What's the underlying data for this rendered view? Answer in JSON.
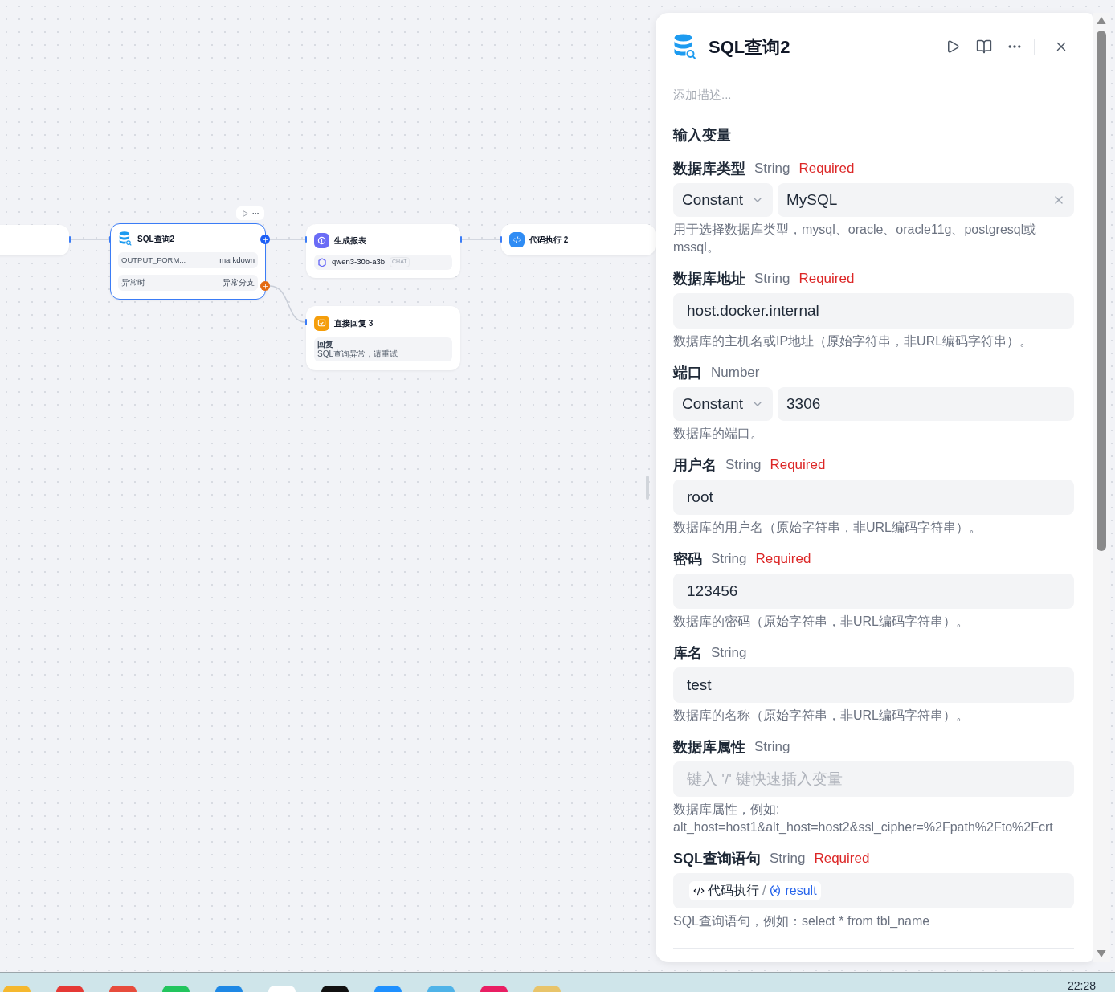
{
  "canvas": {
    "nodes": [
      {
        "kind": "blank",
        "selected": false
      },
      {
        "kind": "sql",
        "selected": true,
        "title": "SQL查询2",
        "rows": [
          {
            "key": "OUTPUT_FORM...",
            "value": "markdown"
          },
          {
            "key": "异常时",
            "value": "异常分支"
          }
        ]
      },
      {
        "kind": "llm",
        "selected": false,
        "title": "生成报表",
        "model": "qwen3-30b-a3b",
        "tag": "CHAT"
      },
      {
        "kind": "code",
        "selected": false,
        "title": "代码执行 2"
      },
      {
        "kind": "reply",
        "selected": false,
        "title": "直接回复 3",
        "label": "回复",
        "text": "SQL查询异常，请重试"
      }
    ]
  },
  "panel": {
    "title": "SQL查询2",
    "description_placeholder": "添加描述...",
    "section_title": "输入变量",
    "fields": [
      {
        "kind": "constant",
        "label": "数据库类型",
        "type": "String",
        "required": "Required",
        "mode": "Constant",
        "value": "MySQL",
        "clearable": true,
        "description": "用于选择数据库类型，mysql、oracle、oracle11g、postgresql或mssql。"
      },
      {
        "kind": "text",
        "label": "数据库地址",
        "type": "String",
        "required": "Required",
        "value": "host.docker.internal",
        "description": "数据库的主机名或IP地址（原始字符串，非URL编码字符串）。"
      },
      {
        "kind": "constant",
        "label": "端口",
        "type": "Number",
        "mode": "Constant",
        "value": "3306",
        "clearable": false,
        "description": "数据库的端口。"
      },
      {
        "kind": "text",
        "label": "用户名",
        "type": "String",
        "required": "Required",
        "value": "root",
        "description": "数据库的用户名（原始字符串，非URL编码字符串）。"
      },
      {
        "kind": "text",
        "label": "密码",
        "type": "String",
        "required": "Required",
        "value": "123456",
        "description": "数据库的密码（原始字符串，非URL编码字符串）。"
      },
      {
        "kind": "text",
        "label": "库名",
        "type": "String",
        "value": "test",
        "description": "数据库的名称（原始字符串，非URL编码字符串）。"
      },
      {
        "kind": "empty",
        "label": "数据库属性",
        "type": "String",
        "placeholder": "键入 '/' 键快速插入变量",
        "description": "数据库属性，例如: alt_host=host1&alt_host=host2&ssl_cipher=%2Fpath%2Fto%2Fcrt"
      },
      {
        "kind": "reference",
        "label": "SQL查询语句",
        "type": "String",
        "required": "Required",
        "node": "代码执行",
        "separator": "/",
        "variable": "result",
        "description": "SQL查询语句，例如：select * from tbl_name"
      }
    ]
  },
  "taskbar": {
    "clock": "22:28"
  }
}
